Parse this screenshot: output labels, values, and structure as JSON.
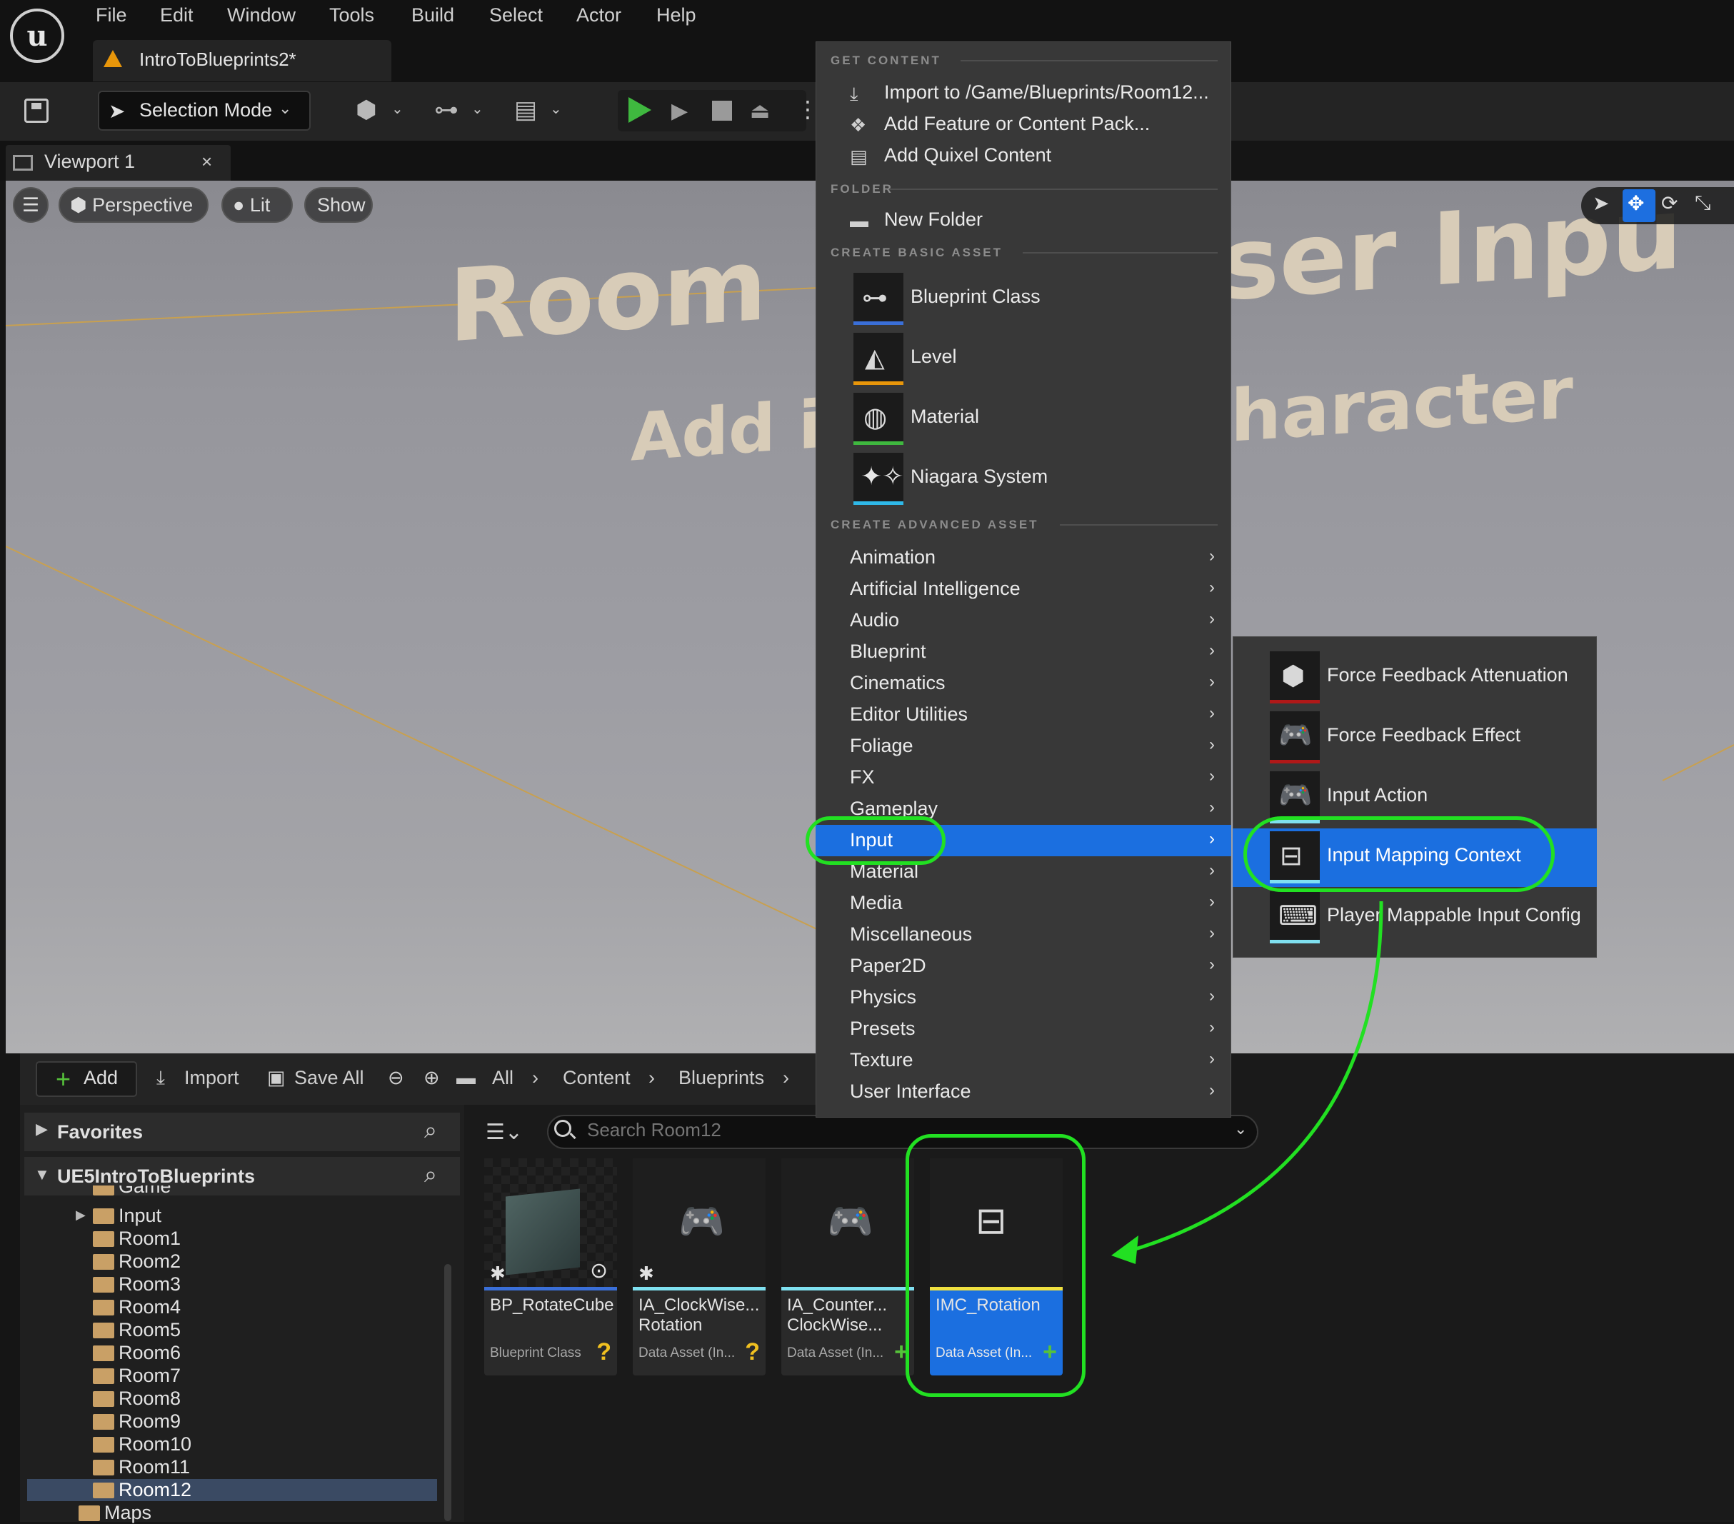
{
  "menubar": {
    "items": [
      "File",
      "Edit",
      "Window",
      "Tools",
      "Build",
      "Select",
      "Actor",
      "Help"
    ],
    "document_tab": "IntroToBlueprints2*"
  },
  "toolbar": {
    "selection_mode": "Selection Mode"
  },
  "viewport": {
    "tab_label": "Viewport 1",
    "tab_close": "×",
    "perspective": "Perspective",
    "lit": "Lit",
    "show": "Show",
    "scene_text": {
      "room": "Room",
      "add_in": "Add in",
      "ser_input": "ser Inpu",
      "haracter": "haracter"
    }
  },
  "context_menu": {
    "sections": {
      "get_content": "GET CONTENT",
      "folder": "FOLDER",
      "create_basic": "CREATE BASIC ASSET",
      "create_advanced": "CREATE ADVANCED ASSET"
    },
    "get_content_items": [
      "Import to /Game/Blueprints/Room12...",
      "Add Feature or Content Pack...",
      "Add Quixel Content"
    ],
    "folder_items": [
      "New Folder"
    ],
    "basic_assets": [
      {
        "label": "Blueprint Class",
        "color": "#3a6fd8"
      },
      {
        "label": "Level",
        "color": "#e8960a"
      },
      {
        "label": "Material",
        "color": "#3fb83f"
      },
      {
        "label": "Niagara System",
        "color": "#2fb8e8"
      }
    ],
    "advanced_assets": [
      "Animation",
      "Artificial Intelligence",
      "Audio",
      "Blueprint",
      "Cinematics",
      "Editor Utilities",
      "Foliage",
      "FX",
      "Gameplay",
      "Input",
      "Material",
      "Media",
      "Miscellaneous",
      "Paper2D",
      "Physics",
      "Presets",
      "Texture",
      "User Interface"
    ],
    "highlighted": "Input",
    "submenu": [
      {
        "label": "Force Feedback Attenuation",
        "color": "#b01818"
      },
      {
        "label": "Force Feedback Effect",
        "color": "#b01818"
      },
      {
        "label": "Input Action",
        "color": "#7fe0f0"
      },
      {
        "label": "Input Mapping Context",
        "color": "#7fe0f0"
      },
      {
        "label": "Player Mappable Input Config",
        "color": "#7fe0f0"
      }
    ],
    "submenu_highlighted": "Input Mapping Context"
  },
  "content_browser": {
    "add": "Add",
    "import": "Import",
    "save_all": "Save All",
    "breadcrumbs": [
      "All",
      "Content",
      "Blueprints"
    ],
    "search_placeholder": "Search Room12",
    "favorites": "Favorites",
    "project": "UE5IntroToBlueprints",
    "tree": [
      "Game",
      "Input",
      "Room1",
      "Room2",
      "Room3",
      "Room4",
      "Room5",
      "Room6",
      "Room7",
      "Room8",
      "Room9",
      "Room10",
      "Room11",
      "Room12",
      "Maps"
    ],
    "selected_folder": "Room12",
    "assets": [
      {
        "name": "BP_RotateCube",
        "type": "Blueprint Class",
        "badge": "?",
        "badge_color": "#f0c020"
      },
      {
        "name": "IA_ClockWise... Rotation",
        "type": "Data Asset (In...",
        "badge": "?",
        "badge_color": "#f0c020"
      },
      {
        "name": "IA_Counter... ClockWise...",
        "type": "Data Asset (In...",
        "badge": "+",
        "badge_color": "#56c23a"
      },
      {
        "name": "IMC_Rotation",
        "type": "Data Asset (In...",
        "badge": "+",
        "badge_color": "#56c23a"
      }
    ]
  }
}
